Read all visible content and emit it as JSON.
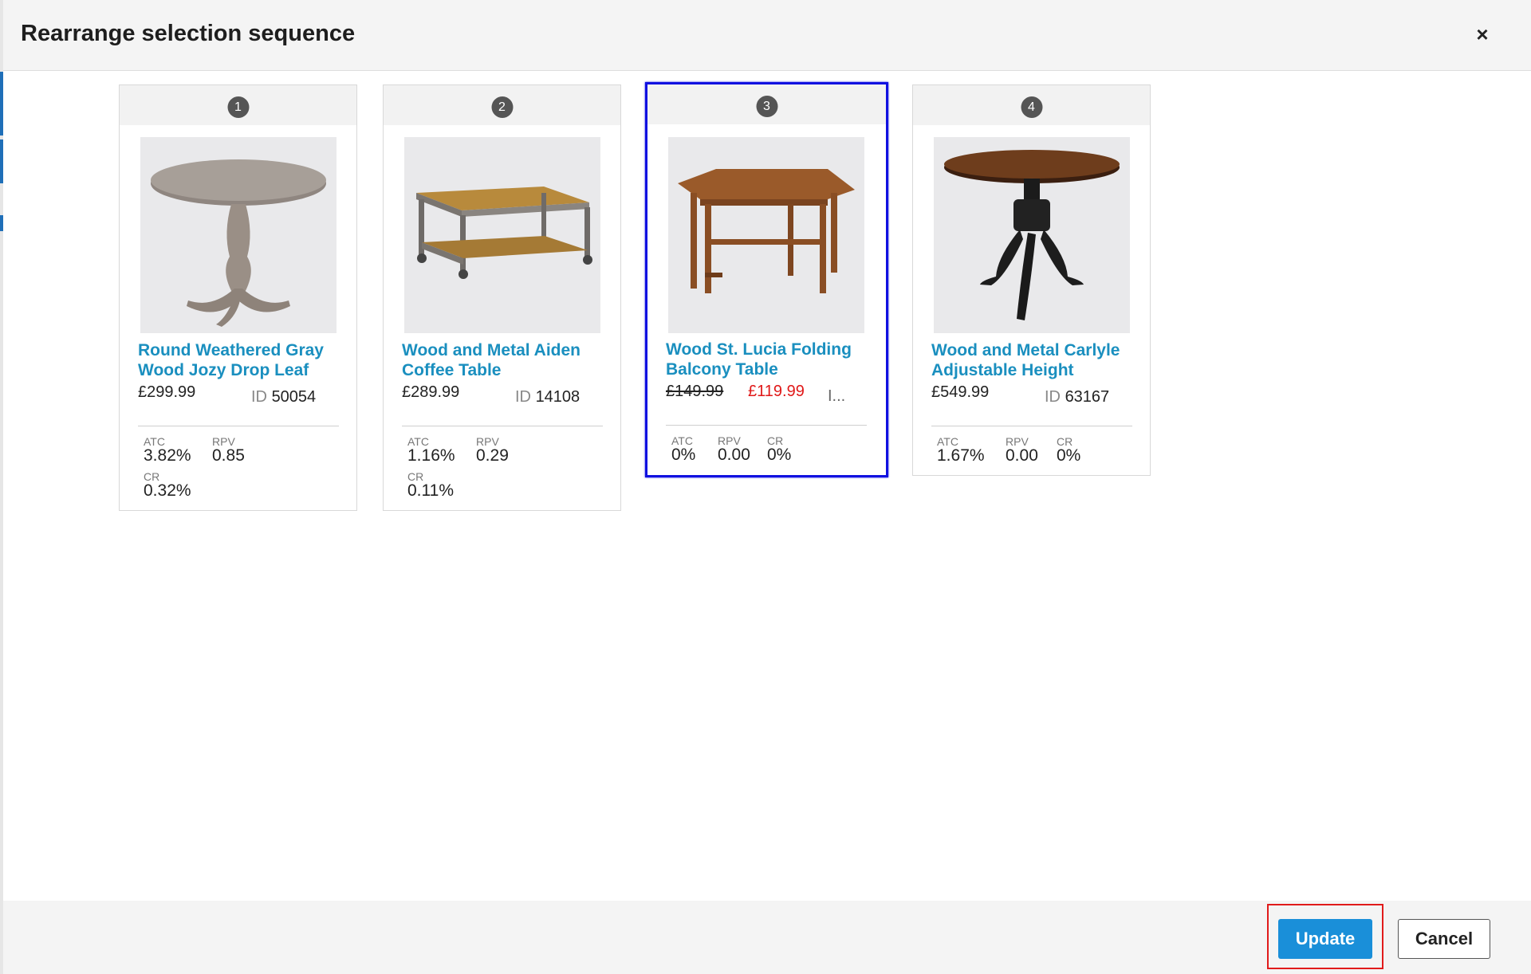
{
  "dialog": {
    "title": "Rearrange selection sequence",
    "close_icon": "close-icon",
    "close_glyph": "×"
  },
  "products": [
    {
      "position": "1",
      "name": "Round Weathered Gray Wood Jozy Drop Leaf",
      "price": "£299.99",
      "id_label": "ID",
      "id": "50054",
      "metrics": {
        "atc_label": "ATC",
        "atc": "3.82%",
        "rpv_label": "RPV",
        "rpv": "0.85",
        "cr_label": "CR",
        "cr": "0.32%"
      }
    },
    {
      "position": "2",
      "name": "Wood and Metal Aiden Coffee Table",
      "price": "£289.99",
      "id_label": "ID",
      "id": "14108",
      "metrics": {
        "atc_label": "ATC",
        "atc": "1.16%",
        "rpv_label": "RPV",
        "rpv": "0.29",
        "cr_label": "CR",
        "cr": "0.11%"
      }
    },
    {
      "position": "3",
      "name": "Wood St. Lucia Folding Balcony Table",
      "price_original": "£149.99",
      "price_sale": "£119.99",
      "id_truncated": "I...",
      "selected": true,
      "metrics": {
        "atc_label": "ATC",
        "atc": "0%",
        "rpv_label": "RPV",
        "rpv": "0.00",
        "cr_label": "CR",
        "cr": "0%"
      }
    },
    {
      "position": "4",
      "name": "Wood and Metal Carlyle Adjustable Height",
      "price": "£549.99",
      "id_label": "ID",
      "id": "63167",
      "metrics": {
        "atc_label": "ATC",
        "atc": "1.67%",
        "rpv_label": "RPV",
        "rpv": "0.00",
        "cr_label": "CR",
        "cr": "0%"
      }
    }
  ],
  "footer": {
    "update_label": "Update",
    "cancel_label": "Cancel"
  },
  "colors": {
    "link": "#1a8fbf",
    "sale": "#e01818",
    "primary_button": "#1a8fd9",
    "selected_border": "#1010e0",
    "highlight": "#e11b1b"
  }
}
